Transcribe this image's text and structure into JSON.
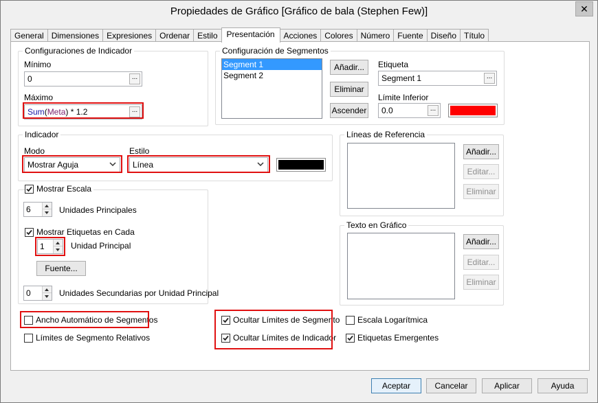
{
  "window": {
    "title": "Propiedades de Gráfico [Gráfico de bala (Stephen Few)]",
    "close_glyph": "✕"
  },
  "tabs": [
    {
      "label": "General"
    },
    {
      "label": "Dimensiones"
    },
    {
      "label": "Expresiones"
    },
    {
      "label": "Ordenar"
    },
    {
      "label": "Estilo"
    },
    {
      "label": "Presentación",
      "active": true
    },
    {
      "label": "Acciones"
    },
    {
      "label": "Colores"
    },
    {
      "label": "Número"
    },
    {
      "label": "Fuente"
    },
    {
      "label": "Diseño"
    },
    {
      "label": "Título"
    }
  ],
  "indicator_config": {
    "title": "Configuraciones de Indicador",
    "min_label": "Mínimo",
    "min_value": "0",
    "max_label": "Máximo",
    "max_func": "Sum",
    "max_paren_open": "(",
    "max_arg": "Meta",
    "max_rest": ") * 1.2",
    "ellipsis": "..."
  },
  "segments": {
    "title": "Configuración de Segmentos",
    "items": [
      "Segment 1",
      "Segment 2"
    ],
    "selected": 0,
    "add_label": "Añadir...",
    "delete_label": "Eliminar",
    "up_label": "Ascender",
    "label_label": "Etiqueta",
    "label_value": "Segment 1",
    "lower_limit_label": "Límite Inferior",
    "lower_limit_value": "0.0",
    "color": "#ff0000"
  },
  "indicator": {
    "title": "Indicador",
    "mode_label": "Modo",
    "mode_value": "Mostrar Aguja",
    "style_label": "Estilo",
    "style_value": "Línea",
    "color": "#000000"
  },
  "scale": {
    "show_scale_label": "Mostrar Escala",
    "show_scale_checked": true,
    "major_units_value": "6",
    "major_units_label": "Unidades Principales",
    "show_labels_label": "Mostrar Etiquetas en Cada",
    "show_labels_checked": true,
    "major_unit_value": "1",
    "major_unit_label": "Unidad Principal",
    "font_label": "Fuente...",
    "minor_units_value": "0",
    "minor_units_label": "Unidades Secundarias por Unidad Principal"
  },
  "reference_lines": {
    "title": "Líneas de Referencia",
    "add_label": "Añadir...",
    "edit_label": "Editar...",
    "delete_label": "Eliminar"
  },
  "chart_text": {
    "title": "Texto en Gráfico",
    "add_label": "Añadir...",
    "edit_label": "Editar...",
    "delete_label": "Eliminar"
  },
  "options": {
    "auto_width_label": "Ancho Automático de Segmentos",
    "auto_width_checked": false,
    "relative_limits_label": "Límites de Segmento Relativos",
    "relative_limits_checked": false,
    "hide_segment_limits_label": "Ocultar Límites de Segmento",
    "hide_segment_limits_checked": true,
    "hide_indicator_limits_label": "Ocultar Límites de Indicador",
    "hide_indicator_limits_checked": true,
    "log_scale_label": "Escala Logarítmica",
    "log_scale_checked": false,
    "popup_labels_label": "Etiquetas Emergentes",
    "popup_labels_checked": true
  },
  "footer": {
    "accept_label": "Aceptar",
    "cancel_label": "Cancelar",
    "apply_label": "Aplicar",
    "help_label": "Ayuda"
  },
  "colors": {
    "highlight": "#e01010",
    "selection": "#3399ff",
    "func_blue": "#1a1aa6",
    "arg_purple": "#7a1f6e"
  }
}
